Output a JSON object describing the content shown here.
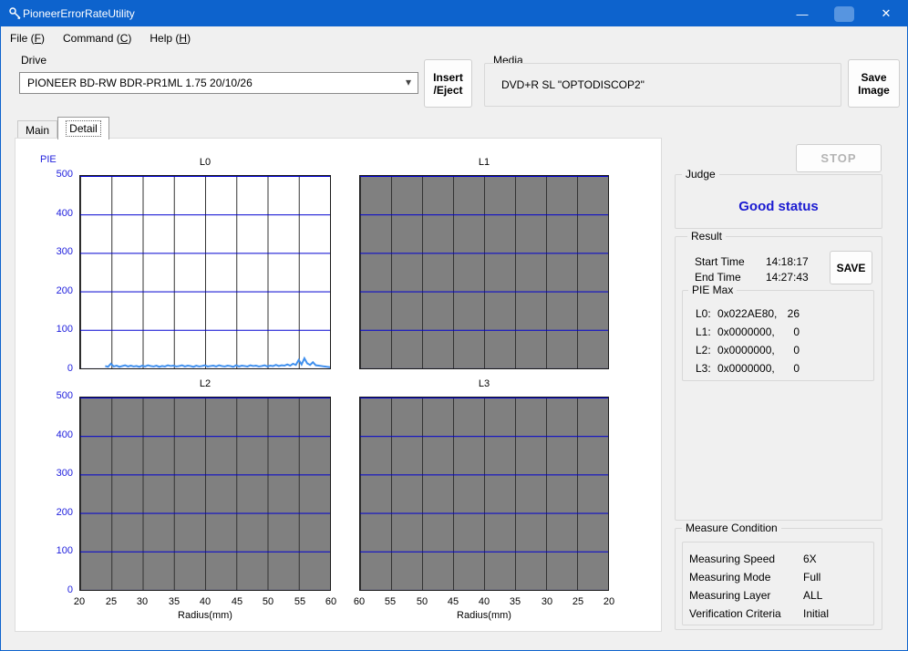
{
  "window": {
    "title": "PioneerErrorRateUtility"
  },
  "menu": {
    "items": [
      {
        "pre": "File (",
        "key": "F",
        "post": ")"
      },
      {
        "pre": "Command (",
        "key": "C",
        "post": ")"
      },
      {
        "pre": "Help (",
        "key": "H",
        "post": ")"
      }
    ]
  },
  "drive": {
    "label": "Drive",
    "value": "PIONEER BD-RW BDR-PR1ML 1.75 20/10/26"
  },
  "media": {
    "label": "Media",
    "value": "DVD+R SL \"OPTODISCOP2\""
  },
  "buttons": {
    "insert_eject": {
      "line1": "Insert",
      "line2": "/Eject"
    },
    "save_image": {
      "line1": "Save",
      "line2": "Image"
    },
    "stop": "STOP",
    "save": "SAVE"
  },
  "tabs": [
    {
      "label": "Main",
      "selected": false
    },
    {
      "label": "Detail",
      "selected": true
    }
  ],
  "axis": {
    "pie_label": "PIE",
    "y_ticks": [
      "500",
      "400",
      "300",
      "200",
      "100",
      "0"
    ],
    "x_l2": [
      "20",
      "25",
      "30",
      "35",
      "40",
      "45",
      "50",
      "55",
      "60"
    ],
    "x_l3": [
      "60",
      "55",
      "50",
      "45",
      "40",
      "35",
      "30",
      "25",
      "20"
    ],
    "x_label": "Radius(mm)"
  },
  "charts": {
    "l0_title": "L0",
    "l1_title": "L1",
    "l2_title": "L2",
    "l3_title": "L3"
  },
  "chart_data": {
    "type": "line",
    "title": "PIE vs Radius, layers L0-L3",
    "xlabel": "Radius(mm)",
    "ylabel": "PIE",
    "ylim": [
      0,
      500
    ],
    "xlim": [
      20,
      60
    ],
    "grid": true,
    "panels": [
      "L0",
      "L1",
      "L2",
      "L3"
    ],
    "series": [
      {
        "name": "L0 PIE",
        "x_start": 24,
        "x_end": 60,
        "values": [
          6,
          4,
          12,
          5,
          7,
          4,
          6,
          8,
          5,
          7,
          5,
          6,
          4,
          7,
          5,
          8,
          6,
          5,
          7,
          4,
          6,
          5,
          8,
          6,
          7,
          5,
          6,
          8,
          5,
          7,
          6,
          4,
          7,
          5,
          6,
          8,
          5,
          6,
          7,
          5,
          8,
          6,
          5,
          7,
          6,
          4,
          8,
          5,
          7,
          6,
          5,
          8,
          6,
          7,
          5,
          6,
          8,
          5,
          7,
          6,
          9,
          6,
          8,
          7,
          10,
          7,
          12,
          9,
          22,
          10,
          26,
          13,
          9,
          16,
          8,
          7,
          6,
          5,
          4,
          3
        ]
      },
      {
        "name": "L1 PIE",
        "values": []
      },
      {
        "name": "L2 PIE",
        "values": []
      },
      {
        "name": "L3 PIE",
        "values": []
      }
    ],
    "trace_color": "#3f8fee"
  },
  "judge": {
    "label": "Judge",
    "status": "Good status"
  },
  "result": {
    "label": "Result",
    "start_time_label": "Start Time",
    "start_time": "14:18:17",
    "end_time_label": "End Time",
    "end_time": "14:27:43",
    "pie_max": {
      "label": "PIE Max",
      "rows": [
        {
          "name": "L0:",
          "hex": "0x022AE80,",
          "count": "26"
        },
        {
          "name": "L1:",
          "hex": "0x0000000,",
          "count": "0"
        },
        {
          "name": "L2:",
          "hex": "0x0000000,",
          "count": "0"
        },
        {
          "name": "L3:",
          "hex": "0x0000000,",
          "count": "0"
        }
      ]
    }
  },
  "measure": {
    "label": "Measure Condition",
    "rows": [
      {
        "name": "Measuring Speed",
        "value": "6X"
      },
      {
        "name": "Measuring Mode",
        "value": "Full"
      },
      {
        "name": "Measuring Layer",
        "value": "ALL"
      },
      {
        "name": "Verification Criteria",
        "value": "Initial"
      }
    ]
  }
}
